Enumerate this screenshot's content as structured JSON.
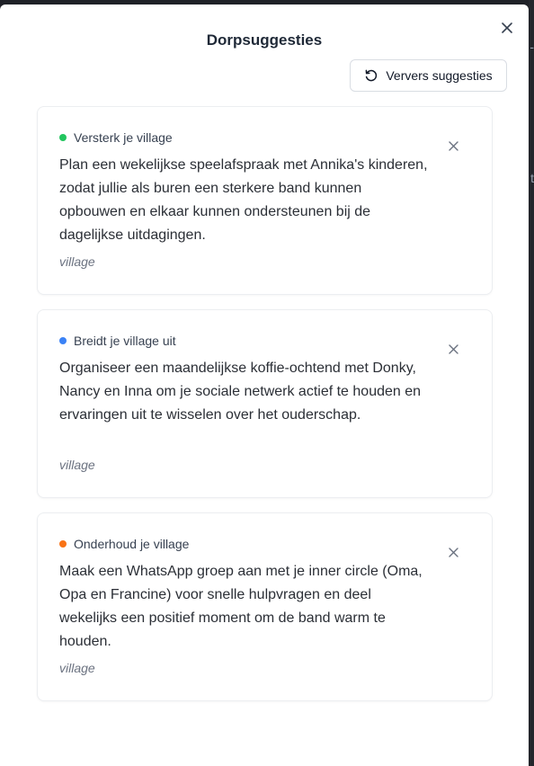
{
  "dialog": {
    "title": "Dorpsuggesties",
    "close_icon": "close-icon",
    "refresh": {
      "label": "Ververs suggesties",
      "icon": "refresh-icon"
    }
  },
  "suggestions": [
    {
      "category": "Versterk je village",
      "dot_color": "#22c55e",
      "text": "Plan een wekelijkse speelafspraak met Annika's kinderen, zodat jullie als buren een sterkere band kunnen opbouwen en elkaar kunnen ondersteunen bij de dagelijkse uitdagingen.",
      "tag": "village"
    },
    {
      "category": "Breidt je village uit",
      "dot_color": "#3b82f6",
      "text": "Organiseer een maandelijkse koffie-ochtend met Donky, Nancy en Inna om je sociale netwerk actief te houden en ervaringen uit te wisselen over het ouderschap.",
      "tag": "village"
    },
    {
      "category": "Onderhoud je village",
      "dot_color": "#f97316",
      "text": "Maak een WhatsApp groep aan met je inner circle (Oma, Opa en Francine) voor snelle hulpvragen en deel wekelijks een positief moment om de band warm te houden.",
      "tag": "village"
    }
  ],
  "backdrop": {
    "glyph_top": "-",
    "glyph_mid": "t"
  }
}
